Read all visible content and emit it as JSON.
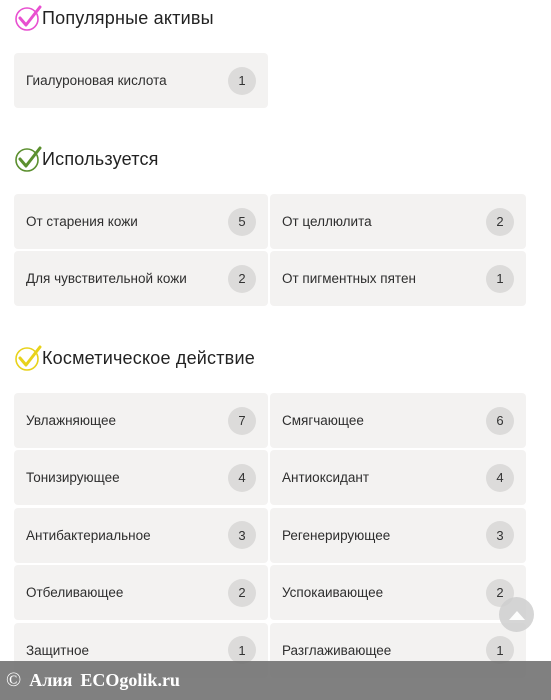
{
  "sections": [
    {
      "title": "Популярные активы",
      "check_color": "#e84fd0",
      "items": [
        {
          "label": "Гиалуроновая кислота",
          "count": "1"
        }
      ]
    },
    {
      "title": "Используется",
      "check_color": "#5b8f2e",
      "items": [
        {
          "label": "От старения кожи",
          "count": "5"
        },
        {
          "label": "От целлюлита",
          "count": "2"
        },
        {
          "label": "Для чувствительной кожи",
          "count": "2"
        },
        {
          "label": "От пигментных пятен",
          "count": "1"
        }
      ]
    },
    {
      "title": "Косметическое действие",
      "check_color": "#e8d21a",
      "items": [
        {
          "label": "Увлажняющее",
          "count": "7"
        },
        {
          "label": "Смягчающее",
          "count": "6"
        },
        {
          "label": "Тонизирующее",
          "count": "4"
        },
        {
          "label": "Антиоксидант",
          "count": "4"
        },
        {
          "label": "Антибактериальное",
          "count": "3"
        },
        {
          "label": "Регенерирующее",
          "count": "3"
        },
        {
          "label": "Отбеливающее",
          "count": "2"
        },
        {
          "label": "Успокаивающее",
          "count": "2"
        },
        {
          "label": "Защитное",
          "count": "1"
        },
        {
          "label": "Разглаживающее",
          "count": "1"
        }
      ]
    }
  ],
  "watermark": {
    "symbol": "©",
    "author": "Алия",
    "site": "ECOgolik.ru"
  },
  "scroll_top": {
    "icon": "arrow-up-icon"
  }
}
